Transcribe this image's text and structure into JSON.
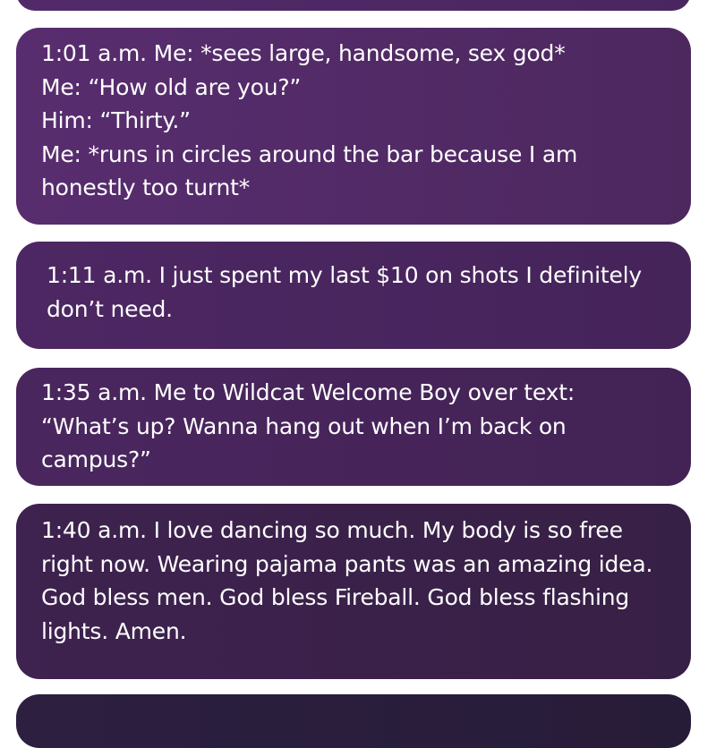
{
  "posts": [
    {
      "lines": [
        "1:01 a.m. Me: *sees large, handsome, sex god*",
        "Me: “How old are you?”",
        "Him: “Thirty.”",
        "Me: *runs in circles around the bar because I am",
        "honestly too turnt*"
      ]
    },
    {
      "lines": [
        "1:11 a.m. I just spent my last $10 on shots I definitely",
        "don’t need."
      ]
    },
    {
      "lines": [
        "1:35 a.m. Me to Wildcat Welcome Boy over text:",
        "“What’s up? Wanna hang out when I’m back on",
        "campus?”"
      ]
    },
    {
      "lines": [
        "1:40 a.m. I love dancing so much. My body is so free",
        "right now. Wearing pajama pants was an amazing idea.",
        "God bless men. God bless Fireball. God bless flashing",
        "lights.  Amen."
      ]
    }
  ],
  "colors": {
    "bubble_text": "#ffffff",
    "bubble_purple_light": "#582d6f",
    "bubble_purple_dark": "#372045",
    "background": "#ffffff"
  }
}
